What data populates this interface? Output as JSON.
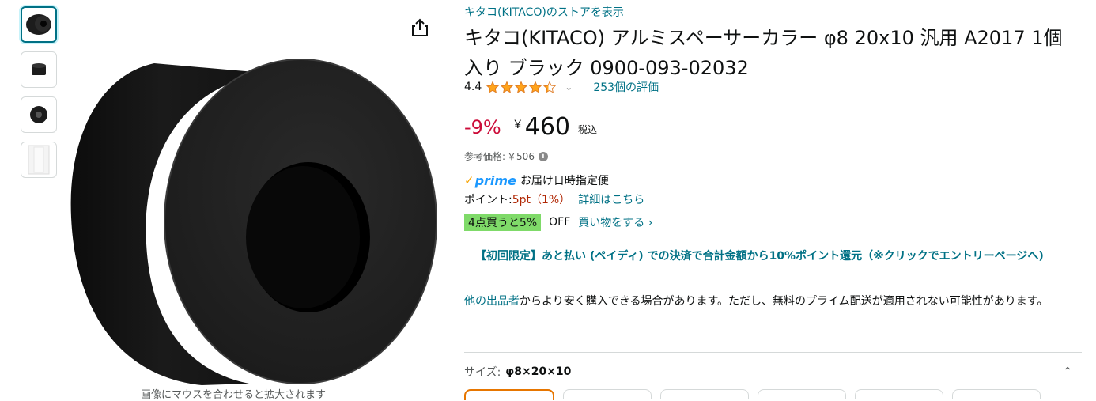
{
  "thumbnails": [
    {
      "name": "thumb-1",
      "selected": true
    },
    {
      "name": "thumb-2",
      "selected": false
    },
    {
      "name": "thumb-3",
      "selected": false
    },
    {
      "name": "thumb-4",
      "selected": false
    }
  ],
  "image_hint": "画像にマウスを合わせると拡大されます",
  "store_link": "キタコ(KITACO)のストアを表示",
  "title": "キタコ(KITACO) アルミスペーサーカラー φ8 20x10 汎用 A2017 1個入り ブラック 0900-093-02032",
  "rating": {
    "value": "4.4",
    "stars": 4.4,
    "review_count": "253個の評価"
  },
  "price": {
    "discount": "-9%",
    "currency": "￥",
    "amount": "460",
    "tax_label": "税込"
  },
  "reference": {
    "label": "参考価格:",
    "price": "￥506"
  },
  "delivery": {
    "prime": "prime",
    "text": "お届け日時指定便"
  },
  "points": {
    "label": "ポイント:",
    "value": "5pt（1%）",
    "link": "詳細はこちら"
  },
  "promo": {
    "badge": "4点買うと5%",
    "off": "OFF",
    "link": "買い物をする ›"
  },
  "paidy": "【初回限定】あと払い (ペイディ) での決済で合計金額から10%ポイント還元（※クリックでエントリーページへ)",
  "other_sellers": {
    "link": "他の出品者",
    "text": "からより安く購入できる場合があります。ただし、無料のプライム配送が適用されない可能性があります。"
  },
  "size": {
    "label": "サイズ:",
    "value": "φ8×20×10"
  },
  "colors": {
    "accent": "#007185",
    "discount": "#cc0c39",
    "promo_green": "#7fda69",
    "prime_blue": "#1a98ff",
    "star": "#ffa41c"
  }
}
